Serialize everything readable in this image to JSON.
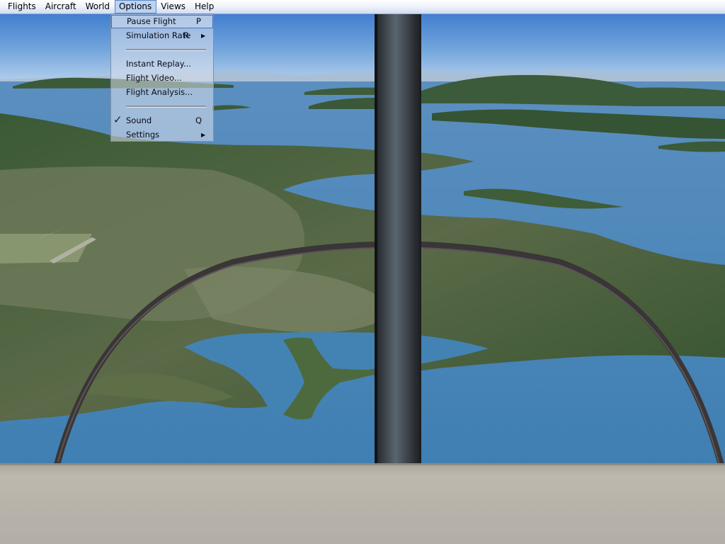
{
  "menubar": {
    "items": [
      {
        "label": "Flights"
      },
      {
        "label": "Aircraft"
      },
      {
        "label": "World"
      },
      {
        "label": "Options"
      },
      {
        "label": "Views"
      },
      {
        "label": "Help"
      }
    ]
  },
  "options_menu": {
    "pause_flight": {
      "label": "Pause Flight",
      "shortcut": "P"
    },
    "simulation_rate": {
      "label": "Simulation Rate",
      "shortcut": "R"
    },
    "instant_replay": {
      "label": "Instant Replay..."
    },
    "flight_video": {
      "label": "Flight Video..."
    },
    "flight_analysis": {
      "label": "Flight Analysis..."
    },
    "sound": {
      "label": "Sound",
      "shortcut": "Q",
      "checked": true
    },
    "settings": {
      "label": "Settings"
    }
  },
  "icons": {
    "submenu": "submenu-arrow-icon",
    "check": "check-icon"
  },
  "colors": {
    "sky_top": "#2c6bc4",
    "water": "#3f82b3",
    "land": "#3e5a33",
    "cockpit_sill": "#b7b2aa",
    "strut": "#2a2d30"
  }
}
